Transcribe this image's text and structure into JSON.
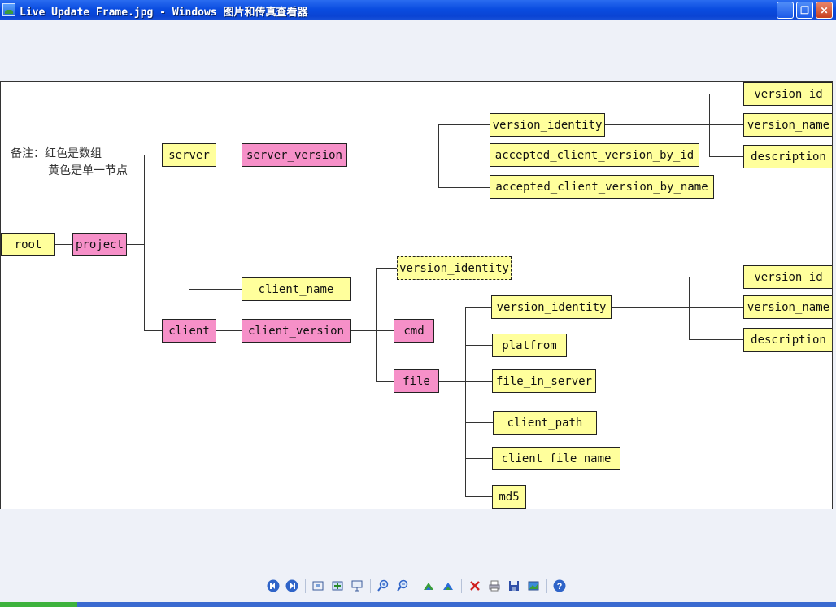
{
  "window": {
    "title": "Live Update Frame.jpg - Windows 图片和传真查看器",
    "minimize_label": "_",
    "maximize_label": "❐",
    "close_label": "✕"
  },
  "legend": {
    "line1": "备注：红色是数组",
    "line2": "黄色是单一节点"
  },
  "nodes": {
    "root": "root",
    "project": "project",
    "server": "server",
    "server_version": "server_version",
    "sv_version_identity": "version_identity",
    "accepted_client_version_by_id": "accepted_client_version_by_id",
    "accepted_client_version_by_name": "accepted_client_version_by_name",
    "sv_version_id": "version id",
    "sv_version_name": "version_name",
    "sv_description": "description",
    "client": "client",
    "client_name": "client_name",
    "client_version": "client_version",
    "cv_version_identity": "version_identity",
    "cmd": "cmd",
    "file": "file",
    "f_version_identity": "version_identity",
    "platfrom": "platfrom",
    "file_in_server": "file_in_server",
    "client_path": "client_path",
    "client_file_name": "client_file_name",
    "md5": "md5",
    "f_version_id": "version id",
    "f_version_name": "version_name",
    "f_description": "description"
  },
  "toolbar": {
    "prev": "previous-image-icon",
    "next": "next-image-icon",
    "best_fit": "best-fit-icon",
    "actual_size": "actual-size-icon",
    "slideshow": "slideshow-icon",
    "zoom_in": "zoom-in-icon",
    "zoom_out": "zoom-out-icon",
    "rotate_cw": "rotate-clockwise-icon",
    "rotate_ccw": "rotate-counterclockwise-icon",
    "delete": "delete-icon",
    "print": "print-icon",
    "save": "save-icon",
    "edit": "edit-icon",
    "help": "help-icon"
  }
}
